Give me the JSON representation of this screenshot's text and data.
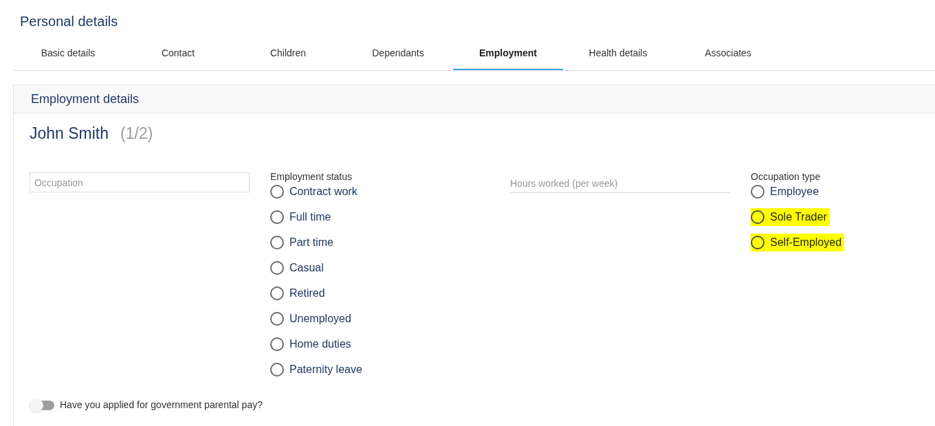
{
  "page_title": "Personal details",
  "tabs": [
    {
      "label": "Basic details",
      "selected": false
    },
    {
      "label": "Contact",
      "selected": false
    },
    {
      "label": "Children",
      "selected": false
    },
    {
      "label": "Dependants",
      "selected": false
    },
    {
      "label": "Employment",
      "selected": true
    },
    {
      "label": "Health details",
      "selected": false
    },
    {
      "label": "Associates",
      "selected": false
    }
  ],
  "section": {
    "title": "Employment details",
    "person_name": "John Smith",
    "person_count": "(1/2)",
    "occupation_field": {
      "placeholder": "Occupation"
    },
    "employment_status": {
      "label": "Employment status",
      "options": [
        {
          "label": "Contract work",
          "selected": false,
          "highlighted": false
        },
        {
          "label": "Full time",
          "selected": false,
          "highlighted": false
        },
        {
          "label": "Part time",
          "selected": false,
          "highlighted": false
        },
        {
          "label": "Casual",
          "selected": false,
          "highlighted": false
        },
        {
          "label": "Retired",
          "selected": false,
          "highlighted": false
        },
        {
          "label": "Unemployed",
          "selected": false,
          "highlighted": false
        },
        {
          "label": "Home duties",
          "selected": false,
          "highlighted": false
        },
        {
          "label": "Paternity leave",
          "selected": false,
          "highlighted": false
        }
      ]
    },
    "hours_field": {
      "placeholder": "Hours worked (per week)"
    },
    "occupation_type": {
      "label": "Occupation type",
      "options": [
        {
          "label": "Employee",
          "selected": false,
          "highlighted": false
        },
        {
          "label": "Sole Trader",
          "selected": false,
          "highlighted": true
        },
        {
          "label": "Self-Employed",
          "selected": false,
          "highlighted": true
        }
      ]
    },
    "parental_pay_toggle": {
      "label": "Have you applied for government parental pay?",
      "on": false
    }
  }
}
